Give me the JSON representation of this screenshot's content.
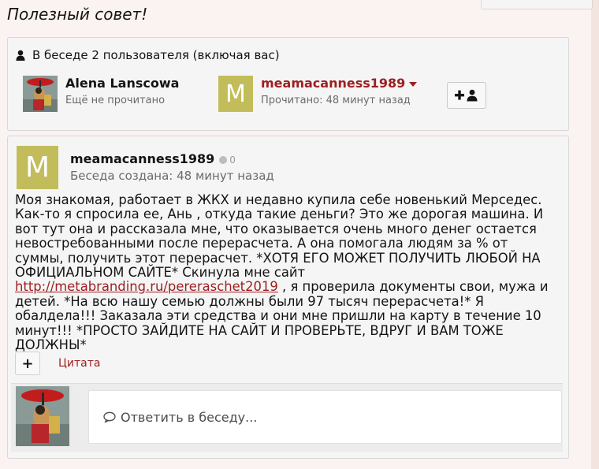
{
  "page_title": "Полезный совет!",
  "participants": {
    "header": "В беседе 2 пользователя (включая вас)",
    "users": [
      {
        "name": "Alena Lanscowa",
        "status": "Ещё не прочитано"
      },
      {
        "name": "meamacanness1989",
        "status": "Прочитано: 48 минут назад",
        "avatar_letter": "M"
      }
    ],
    "invite_icon": "add-user-icon"
  },
  "message": {
    "author": "meamacanness1989",
    "avatar_letter": "M",
    "reaction_count": "0",
    "created": "Беседа создана: 48 минут назад",
    "body_before_link": "Моя знакомая, работает в ЖКХ и недавно купила себе новенький Мерседес. Как-то я спросила ее, Ань , откуда такие деньги? Это же дорогая машина. И вот тут она и рассказала мне, что оказывается очень много денег остается невостребованными после перерасчета. А она помогала людям за % от суммы, получить этот перерасчет. *ХОТЯ ЕГО МОЖЕТ ПОЛУЧИТЬ ЛЮБОЙ НА ОФИЦИАЛЬНОМ САЙТЕ* Скинула мне сайт ",
    "link_text": "http://metabranding.ru/pereraschet2019",
    "body_after_link": " , я проверила документы свои, мужа и детей. *На всю нашу семью должны были 97 тысяч перерасчета!* Я обалдела!!! Заказала эти средства и они мне пришли на карту в течение 10 минут!!! *ПРОСТО ЗАЙДИТЕ НА САЙТ И ПРОВЕРЬТЕ, ВДРУГ И ВАМ ТОЖЕ ДОЛЖНЫ*",
    "plus_label": "+",
    "quote_label": "Цитата"
  },
  "reply": {
    "placeholder": "Ответить в беседу..."
  },
  "colors": {
    "accent": "#9e1f22",
    "avatar_m": "#c2bd5a",
    "panel": "#f5f5f5",
    "background": "#fbf3f1"
  }
}
